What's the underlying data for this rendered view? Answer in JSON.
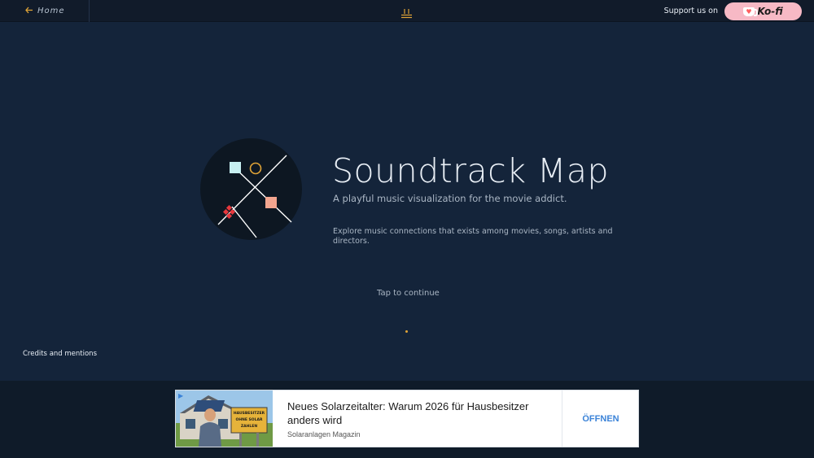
{
  "nav": {
    "home_label": "Home",
    "support_label": "Support us on",
    "kofi_label": "Ko-fi"
  },
  "hero": {
    "title": "Soundtrack Map",
    "subtitle": "A playful music visualization for the movie addict.",
    "description": "Explore music connections that exists among movies, songs, artists and directors.",
    "tap_label": "Tap to continue"
  },
  "footer": {
    "credits_label": "Credits and mentions"
  },
  "ad": {
    "title": "Neues Solarzeitalter: Warum 2026 für Hausbesitzer anders wird",
    "source": "Solaranlagen Magazin",
    "cta": "ÖFFNEN",
    "sign_text": "HAUSBESITZER OHNE SOLAR ZAHLEN"
  },
  "colors": {
    "background": "#14243a",
    "nav_background": "#111b2a",
    "accent": "#e0a437",
    "kofi_pink": "#f7b9c5",
    "ad_cta": "#3b83d8"
  },
  "icons": [
    "arrow-left-icon",
    "menu-icon",
    "kofi-cup-icon",
    "ad-choices-icon"
  ]
}
